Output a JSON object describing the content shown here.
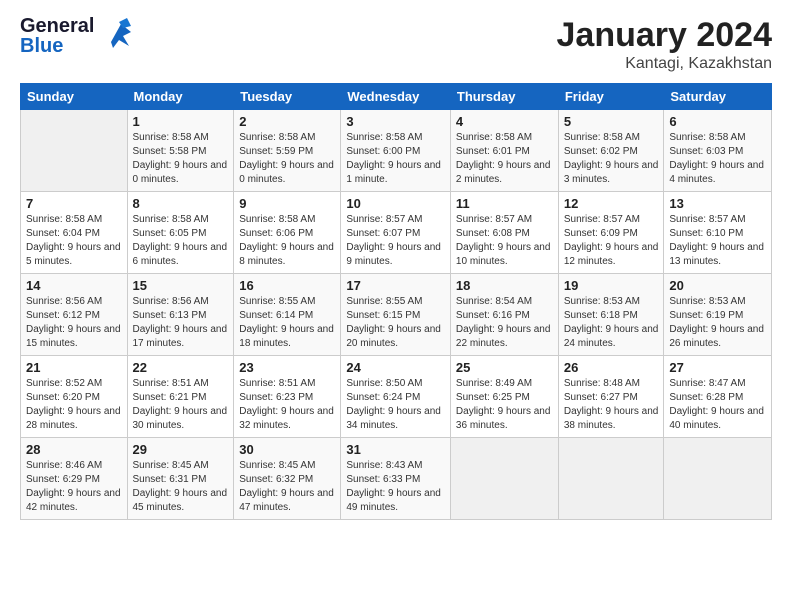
{
  "logo": {
    "line1": "General",
    "line2": "Blue"
  },
  "title": "January 2024",
  "subtitle": "Kantagi, Kazakhstan",
  "days_of_week": [
    "Sunday",
    "Monday",
    "Tuesday",
    "Wednesday",
    "Thursday",
    "Friday",
    "Saturday"
  ],
  "weeks": [
    [
      {
        "day": "",
        "sunrise": "",
        "sunset": "",
        "daylight": ""
      },
      {
        "day": "1",
        "sunrise": "Sunrise: 8:58 AM",
        "sunset": "Sunset: 5:58 PM",
        "daylight": "Daylight: 9 hours and 0 minutes."
      },
      {
        "day": "2",
        "sunrise": "Sunrise: 8:58 AM",
        "sunset": "Sunset: 5:59 PM",
        "daylight": "Daylight: 9 hours and 0 minutes."
      },
      {
        "day": "3",
        "sunrise": "Sunrise: 8:58 AM",
        "sunset": "Sunset: 6:00 PM",
        "daylight": "Daylight: 9 hours and 1 minute."
      },
      {
        "day": "4",
        "sunrise": "Sunrise: 8:58 AM",
        "sunset": "Sunset: 6:01 PM",
        "daylight": "Daylight: 9 hours and 2 minutes."
      },
      {
        "day": "5",
        "sunrise": "Sunrise: 8:58 AM",
        "sunset": "Sunset: 6:02 PM",
        "daylight": "Daylight: 9 hours and 3 minutes."
      },
      {
        "day": "6",
        "sunrise": "Sunrise: 8:58 AM",
        "sunset": "Sunset: 6:03 PM",
        "daylight": "Daylight: 9 hours and 4 minutes."
      }
    ],
    [
      {
        "day": "7",
        "sunrise": "Sunrise: 8:58 AM",
        "sunset": "Sunset: 6:04 PM",
        "daylight": "Daylight: 9 hours and 5 minutes."
      },
      {
        "day": "8",
        "sunrise": "Sunrise: 8:58 AM",
        "sunset": "Sunset: 6:05 PM",
        "daylight": "Daylight: 9 hours and 6 minutes."
      },
      {
        "day": "9",
        "sunrise": "Sunrise: 8:58 AM",
        "sunset": "Sunset: 6:06 PM",
        "daylight": "Daylight: 9 hours and 8 minutes."
      },
      {
        "day": "10",
        "sunrise": "Sunrise: 8:57 AM",
        "sunset": "Sunset: 6:07 PM",
        "daylight": "Daylight: 9 hours and 9 minutes."
      },
      {
        "day": "11",
        "sunrise": "Sunrise: 8:57 AM",
        "sunset": "Sunset: 6:08 PM",
        "daylight": "Daylight: 9 hours and 10 minutes."
      },
      {
        "day": "12",
        "sunrise": "Sunrise: 8:57 AM",
        "sunset": "Sunset: 6:09 PM",
        "daylight": "Daylight: 9 hours and 12 minutes."
      },
      {
        "day": "13",
        "sunrise": "Sunrise: 8:57 AM",
        "sunset": "Sunset: 6:10 PM",
        "daylight": "Daylight: 9 hours and 13 minutes."
      }
    ],
    [
      {
        "day": "14",
        "sunrise": "Sunrise: 8:56 AM",
        "sunset": "Sunset: 6:12 PM",
        "daylight": "Daylight: 9 hours and 15 minutes."
      },
      {
        "day": "15",
        "sunrise": "Sunrise: 8:56 AM",
        "sunset": "Sunset: 6:13 PM",
        "daylight": "Daylight: 9 hours and 17 minutes."
      },
      {
        "day": "16",
        "sunrise": "Sunrise: 8:55 AM",
        "sunset": "Sunset: 6:14 PM",
        "daylight": "Daylight: 9 hours and 18 minutes."
      },
      {
        "day": "17",
        "sunrise": "Sunrise: 8:55 AM",
        "sunset": "Sunset: 6:15 PM",
        "daylight": "Daylight: 9 hours and 20 minutes."
      },
      {
        "day": "18",
        "sunrise": "Sunrise: 8:54 AM",
        "sunset": "Sunset: 6:16 PM",
        "daylight": "Daylight: 9 hours and 22 minutes."
      },
      {
        "day": "19",
        "sunrise": "Sunrise: 8:53 AM",
        "sunset": "Sunset: 6:18 PM",
        "daylight": "Daylight: 9 hours and 24 minutes."
      },
      {
        "day": "20",
        "sunrise": "Sunrise: 8:53 AM",
        "sunset": "Sunset: 6:19 PM",
        "daylight": "Daylight: 9 hours and 26 minutes."
      }
    ],
    [
      {
        "day": "21",
        "sunrise": "Sunrise: 8:52 AM",
        "sunset": "Sunset: 6:20 PM",
        "daylight": "Daylight: 9 hours and 28 minutes."
      },
      {
        "day": "22",
        "sunrise": "Sunrise: 8:51 AM",
        "sunset": "Sunset: 6:21 PM",
        "daylight": "Daylight: 9 hours and 30 minutes."
      },
      {
        "day": "23",
        "sunrise": "Sunrise: 8:51 AM",
        "sunset": "Sunset: 6:23 PM",
        "daylight": "Daylight: 9 hours and 32 minutes."
      },
      {
        "day": "24",
        "sunrise": "Sunrise: 8:50 AM",
        "sunset": "Sunset: 6:24 PM",
        "daylight": "Daylight: 9 hours and 34 minutes."
      },
      {
        "day": "25",
        "sunrise": "Sunrise: 8:49 AM",
        "sunset": "Sunset: 6:25 PM",
        "daylight": "Daylight: 9 hours and 36 minutes."
      },
      {
        "day": "26",
        "sunrise": "Sunrise: 8:48 AM",
        "sunset": "Sunset: 6:27 PM",
        "daylight": "Daylight: 9 hours and 38 minutes."
      },
      {
        "day": "27",
        "sunrise": "Sunrise: 8:47 AM",
        "sunset": "Sunset: 6:28 PM",
        "daylight": "Daylight: 9 hours and 40 minutes."
      }
    ],
    [
      {
        "day": "28",
        "sunrise": "Sunrise: 8:46 AM",
        "sunset": "Sunset: 6:29 PM",
        "daylight": "Daylight: 9 hours and 42 minutes."
      },
      {
        "day": "29",
        "sunrise": "Sunrise: 8:45 AM",
        "sunset": "Sunset: 6:31 PM",
        "daylight": "Daylight: 9 hours and 45 minutes."
      },
      {
        "day": "30",
        "sunrise": "Sunrise: 8:45 AM",
        "sunset": "Sunset: 6:32 PM",
        "daylight": "Daylight: 9 hours and 47 minutes."
      },
      {
        "day": "31",
        "sunrise": "Sunrise: 8:43 AM",
        "sunset": "Sunset: 6:33 PM",
        "daylight": "Daylight: 9 hours and 49 minutes."
      },
      {
        "day": "",
        "sunrise": "",
        "sunset": "",
        "daylight": ""
      },
      {
        "day": "",
        "sunrise": "",
        "sunset": "",
        "daylight": ""
      },
      {
        "day": "",
        "sunrise": "",
        "sunset": "",
        "daylight": ""
      }
    ]
  ]
}
